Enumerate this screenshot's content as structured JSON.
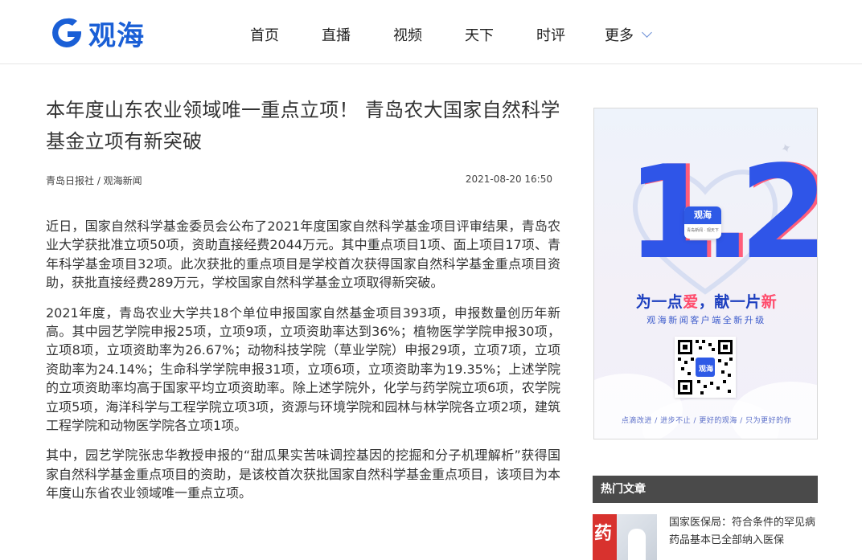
{
  "brand": {
    "logo_text": "观海",
    "color": "#1a5fd6"
  },
  "nav": {
    "items": [
      "首页",
      "直播",
      "视频",
      "天下",
      "时评"
    ],
    "more_label": "更多"
  },
  "article": {
    "title": "本年度山东农业领域唯一重点立项！ 青岛农大国家自然科学基金立项有新突破",
    "source": "青岛日报社 / 观海新闻",
    "time": "2021-08-20 16:50",
    "paragraphs": [
      "近日，国家自然科学基金委员会公布了2021年度国家自然科学基金项目评审结果，青岛农业大学获批准立项50项，资助直接经费2044万元。其中重点项目1项、面上项目17项、青年科学基金项目32项。此次获批的重点项目是学校首次获得国家自然科学基金重点项目资助，获批直接经费289万元，学校国家自然科学基金立项取得新突破。",
      "2021年度，青岛农业大学共18个单位申报国家自然基金项目393项，申报数量创历年新高。其中园艺学院申报25项，立项9项，立项资助率达到36%；植物医学学院申报30项，立项8项，立项资助率为26.67%；动物科技学院（草业学院）申报29项，立项7项，立项资助率为24.14%；生命科学学院申报31项，立项6项，立项资助率为19.35%；上述学院的立项资助率均高于国家平均立项资助率。除上述学院外，化学与药学院立项6项，农学院立项5项，海洋科学与工程学院立项3项，资源与环境学院和园林与林学院各立项2项，建筑工程学院和动物医学院各立项1项。",
      "其中，园艺学院张忠华教授申报的“甜瓜果实苦味调控基因的挖掘和分子机理解析”获得国家自然科学基金重点项目的资助，是该校首次获批国家自然科学基金重点项目，该项目为本年度山东省农业领域唯一重点立项。"
    ]
  },
  "ad": {
    "number": "1.2",
    "badge_label": "观海",
    "badge_sub": "青岛新闻 · 观天下",
    "slogan_a": "为一点",
    "slogan_red_a": "爱",
    "slogan_b": "，献一片",
    "slogan_red_b": "新",
    "subline": "观海新闻客户端全新升级",
    "qr_label": "观海",
    "footline": "点滴改进 / 进步不止 / 更好的观海 / 只为更好的你"
  },
  "hot": {
    "title": "热门文章",
    "items": [
      {
        "thumb_char": "药",
        "text": "国家医保局：符合条件的罕见病药品基本已全部纳入医保"
      }
    ]
  }
}
